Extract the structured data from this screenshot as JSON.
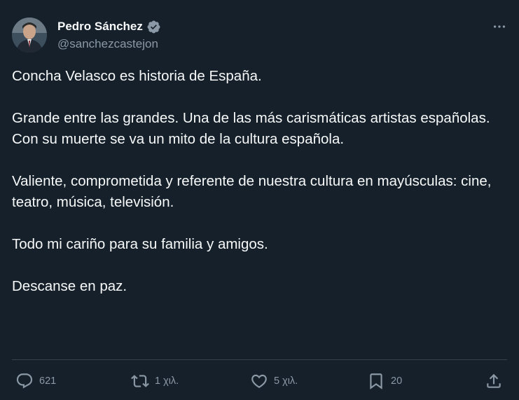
{
  "author": {
    "display_name": "Pedro Sánchez",
    "handle": "@sanchezcastejon",
    "verified_color": "#8b98a5"
  },
  "tweet": {
    "paragraphs": [
      "Concha Velasco es historia de España.",
      "Grande entre las grandes. Una de las más carismáticas artistas españolas. Con su muerte se va un mito de la cultura española.",
      "Valiente, comprometida y referente de nuestra cultura en mayúsculas: cine, teatro, música, televisión.",
      "Todo mi cariño para su familia y amigos.",
      "Descanse en paz."
    ]
  },
  "actions": {
    "reply_count": "621",
    "retweet_count": "1 χιλ.",
    "like_count": "5 χιλ.",
    "bookmark_count": "20"
  },
  "icons": {
    "more": "more-horizontal-icon",
    "verified": "verified-badge-icon",
    "reply": "reply-icon",
    "retweet": "retweet-icon",
    "like": "heart-icon",
    "bookmark": "bookmark-icon",
    "share": "share-icon"
  },
  "colors": {
    "background": "#15202b",
    "text_primary": "#f7f9f9",
    "text_secondary": "#8b98a5",
    "divider": "#38444d"
  }
}
